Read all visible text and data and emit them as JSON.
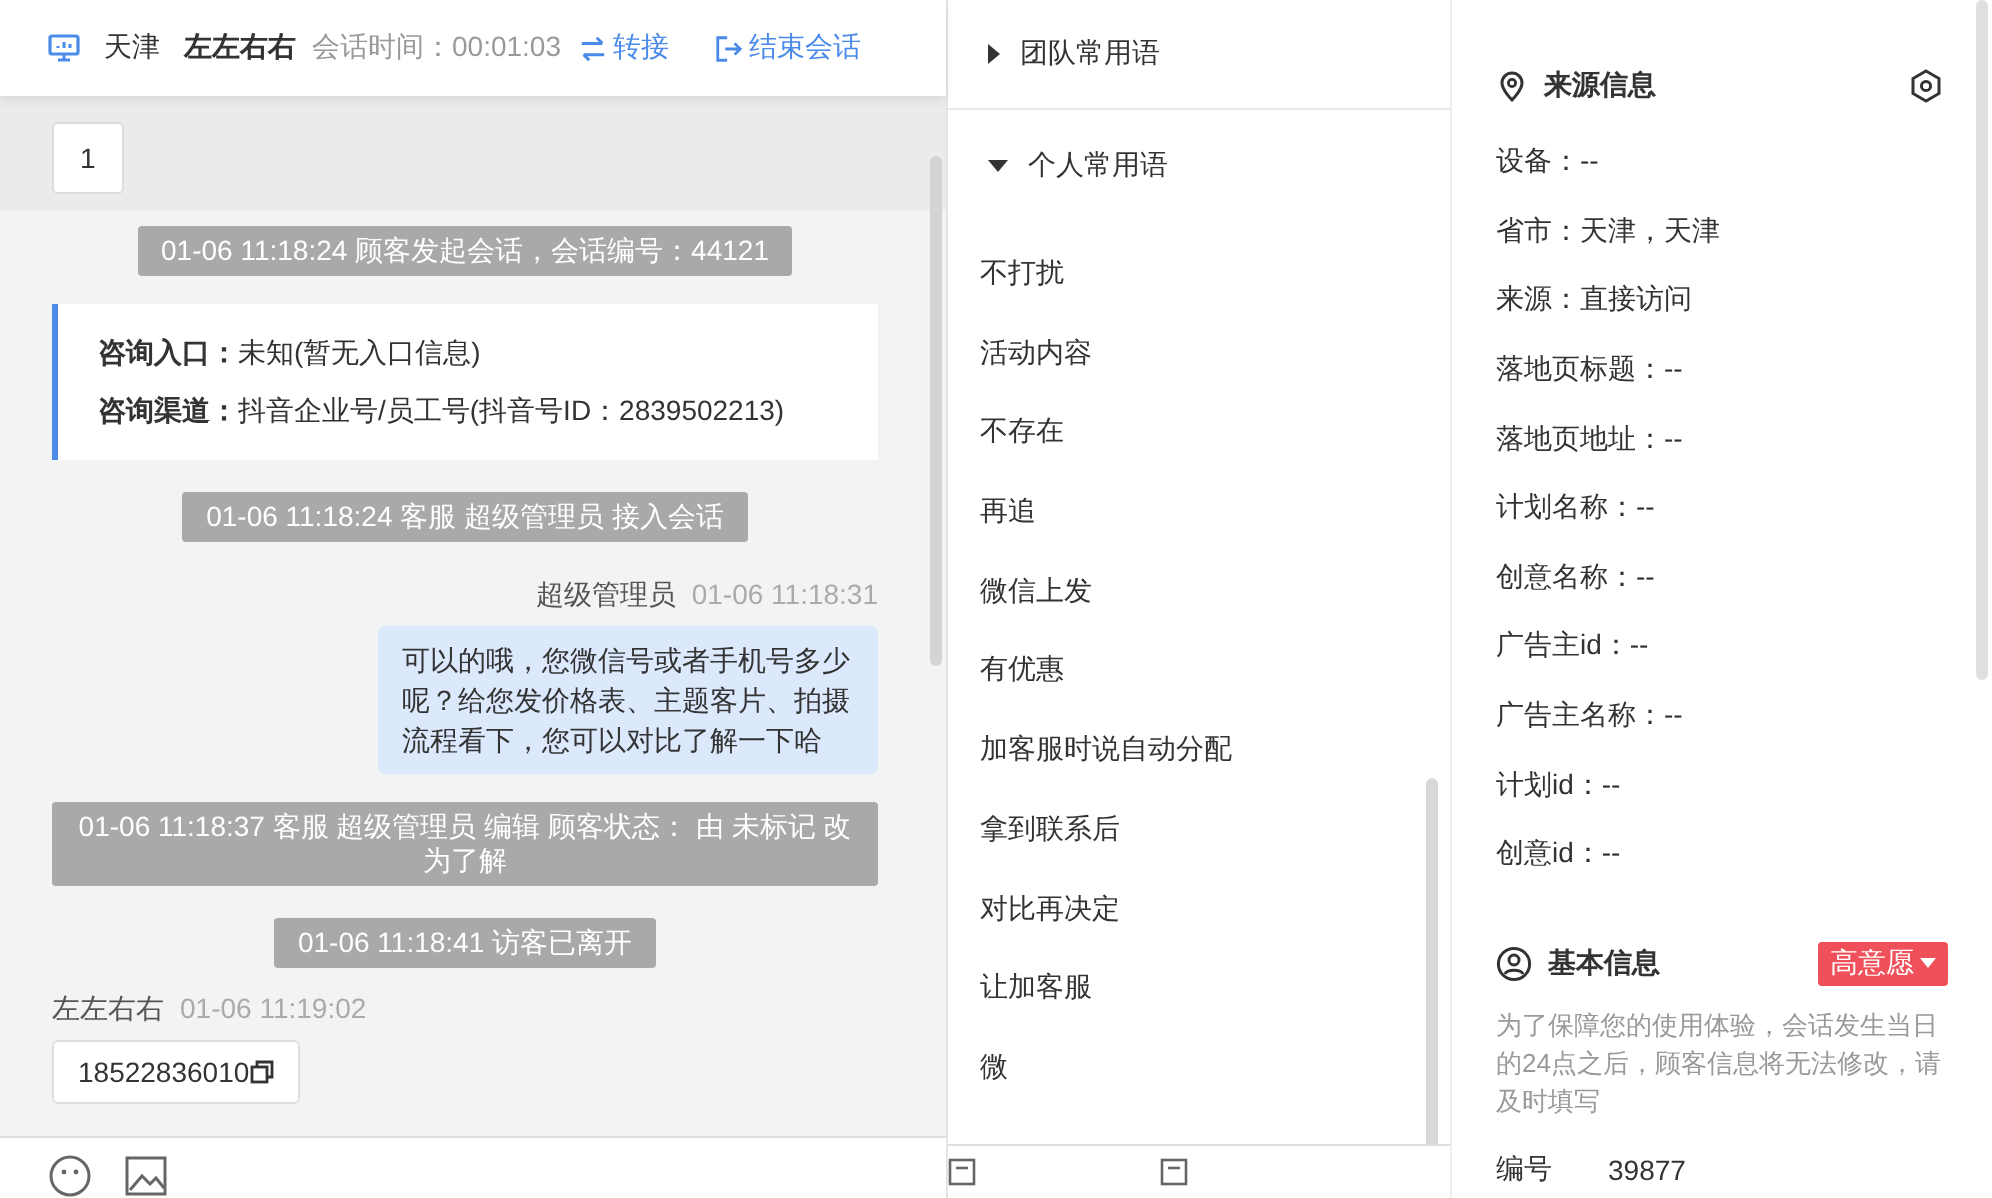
{
  "header": {
    "city": "天津",
    "visitor": "左左右右",
    "duration_label": "会话时间：",
    "duration": "00:01:03",
    "transfer": "转接",
    "end": "结束会话"
  },
  "messages": [
    {
      "kind": "customer_text",
      "text": "1"
    },
    {
      "kind": "notice",
      "text": "01-06 11:18:24 顾客发起会话，会话编号：44121"
    },
    {
      "kind": "info_card",
      "lines": [
        {
          "label": "咨询入口：",
          "value": "未知(暂无入口信息)"
        },
        {
          "label": "咨询渠道：",
          "value": "抖音企业号/员工号(抖音号ID：2839502213)"
        }
      ]
    },
    {
      "kind": "notice",
      "text": "01-06 11:18:24 客服 超级管理员 接入会话"
    },
    {
      "kind": "agent",
      "sender": "超级管理员",
      "time": "01-06 11:18:31",
      "text": "可以的哦，您微信号或者手机号多少呢？给您发价格表、主题客片、拍摄流程看下，您可以对比了解一下哈"
    },
    {
      "kind": "notice",
      "text": "01-06 11:18:37 客服 超级管理员 编辑 顾客状态： 由 未标记 改为了解"
    },
    {
      "kind": "notice",
      "text": "01-06 11:18:41 访客已离开"
    },
    {
      "kind": "customer",
      "sender": "左左右右",
      "time": "01-06 11:19:02",
      "text": "18522836010"
    }
  ],
  "phrase_groups": [
    {
      "title": "团队常用语",
      "expanded": false
    },
    {
      "title": "个人常用语",
      "expanded": true,
      "items": [
        "不打扰",
        "活动内容",
        "不存在",
        "再追",
        "微信上发",
        "有优惠",
        "加客服时说自动分配",
        "拿到联系后",
        "对比再决定",
        "让加客服",
        "微"
      ]
    }
  ],
  "source_info": {
    "title": "来源信息",
    "fields": [
      "设备：--",
      "省市：天津，天津",
      "来源：直接访问",
      "落地页标题：--",
      "落地页地址：--",
      "计划名称：--",
      "创意名称：--",
      "广告主id：--",
      "广告主名称：--",
      "计划id：--",
      "创意id：--"
    ]
  },
  "basic_info": {
    "title": "基本信息",
    "tag": "高意愿",
    "note": "为了保障您的使用体验，会话发生当日的24点之后，顾客信息将无法修改，请及时填写",
    "fields": [
      {
        "label": "编号",
        "value": "39877"
      }
    ]
  }
}
